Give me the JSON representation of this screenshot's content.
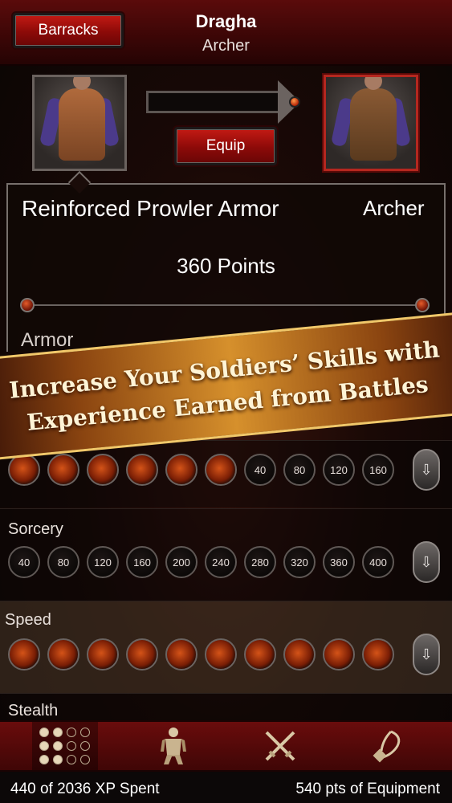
{
  "header": {
    "back_label": "Barracks",
    "soldier_name": "Dragha",
    "soldier_class": "Archer"
  },
  "equip_area": {
    "equip_label": "Equip"
  },
  "item": {
    "name": "Reinforced Prowler Armor",
    "class": "Archer",
    "points": "360 Points",
    "stat_label": "Armor"
  },
  "banner": {
    "line1": "Increase Your Soldiers’ Skills with",
    "line2": "Experience Earned from Battles"
  },
  "skills": {
    "armor": {
      "label": "Armor",
      "filled_count": 6,
      "values": [
        "40",
        "80",
        "120",
        "160"
      ]
    },
    "sorcery": {
      "label": "Sorcery",
      "values": [
        "40",
        "80",
        "120",
        "160",
        "200",
        "240",
        "280",
        "320",
        "360",
        "400"
      ]
    },
    "speed": {
      "label": "Speed",
      "filled_count": 10
    },
    "stealth": {
      "label": "Stealth"
    }
  },
  "tabs": [
    {
      "name": "skills-tab",
      "icon": "grid-dots-icon",
      "active": true
    },
    {
      "name": "armor-tab",
      "icon": "armor-figure-icon",
      "active": false
    },
    {
      "name": "weapons-tab",
      "icon": "crossed-swords-icon",
      "active": false
    },
    {
      "name": "accessory-tab",
      "icon": "amulet-icon",
      "active": false
    }
  ],
  "footer": {
    "xp_spent": "440 of 2036 XP Spent",
    "equipment_points": "540 pts of Equipment"
  },
  "colors": {
    "header_red": "#5a0b0b",
    "button_red": "#c31a14",
    "banner_gold": "#d6902c"
  }
}
